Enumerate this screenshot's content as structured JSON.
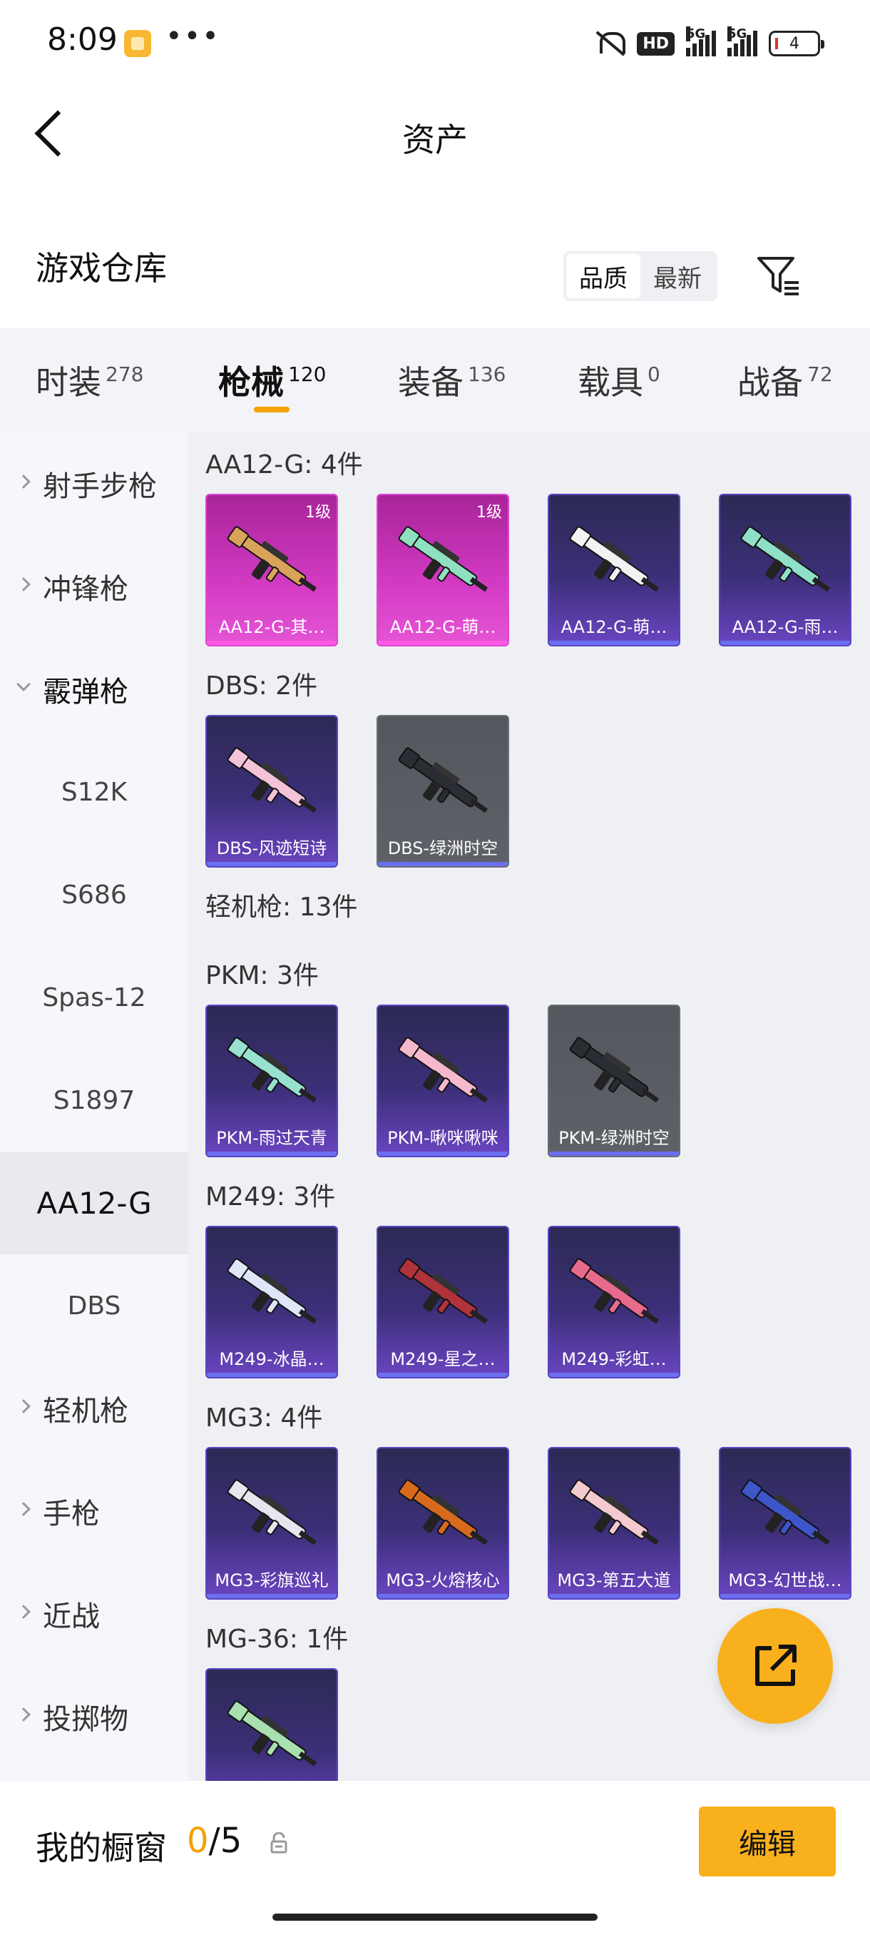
{
  "status": {
    "time": "8:09",
    "dots": "•••",
    "hd": "HD",
    "sig1": "5G",
    "sig2": "5G",
    "battery": "4"
  },
  "header": {
    "title": "资产"
  },
  "warehouse": {
    "title": "游戏仓库",
    "sort": [
      "品质",
      "最新"
    ],
    "sort_active": 0
  },
  "tabs": [
    {
      "label": "时装",
      "count": "278"
    },
    {
      "label": "枪械",
      "count": "120",
      "active": true
    },
    {
      "label": "装备",
      "count": "136"
    },
    {
      "label": "载具",
      "count": "0"
    },
    {
      "label": "战备",
      "count": "72"
    }
  ],
  "leftnav": [
    {
      "label": "射手步枪",
      "type": "parent"
    },
    {
      "label": "冲锋枪",
      "type": "parent"
    },
    {
      "label": "霰弹枪",
      "type": "parent-open"
    },
    {
      "label": "S12K",
      "type": "child"
    },
    {
      "label": "S686",
      "type": "child"
    },
    {
      "label": "Spas-12",
      "type": "child"
    },
    {
      "label": "S1897",
      "type": "child"
    },
    {
      "label": "AA12-G",
      "type": "selected"
    },
    {
      "label": "DBS",
      "type": "child"
    },
    {
      "label": "轻机枪",
      "type": "parent"
    },
    {
      "label": "手枪",
      "type": "parent"
    },
    {
      "label": "近战",
      "type": "parent"
    },
    {
      "label": "投掷物",
      "type": "parent"
    }
  ],
  "groups": [
    {
      "title": "AA12-G: 4件",
      "items": [
        {
          "name": "AA12-G-其…",
          "rarity": "pink",
          "level": "1级",
          "color": "#d9a35a"
        },
        {
          "name": "AA12-G-萌…",
          "rarity": "pink",
          "level": "1级",
          "color": "#8fe0c0"
        },
        {
          "name": "AA12-G-萌…",
          "rarity": "purple",
          "color": "#f2f2f2"
        },
        {
          "name": "AA12-G-雨…",
          "rarity": "purple",
          "color": "#8fe0c8"
        }
      ]
    },
    {
      "title": "DBS: 2件",
      "items": [
        {
          "name": "DBS-风迹短诗",
          "rarity": "purple",
          "color": "#f4c3d8"
        },
        {
          "name": "DBS-绿洲时空",
          "rarity": "gray",
          "color": "#2a2d33"
        }
      ]
    },
    {
      "title": "轻机枪: 13件",
      "items": []
    },
    {
      "title": "PKM: 3件",
      "items": [
        {
          "name": "PKM-雨过天青",
          "rarity": "purple",
          "color": "#98e0d0"
        },
        {
          "name": "PKM-啾咪啾咪",
          "rarity": "purple",
          "color": "#f5b8cc"
        },
        {
          "name": "PKM-绿洲时空",
          "rarity": "gray",
          "color": "#2a2d33"
        }
      ]
    },
    {
      "title": "M249: 3件",
      "items": [
        {
          "name": "M249-冰晶…",
          "rarity": "purple",
          "color": "#dfe6f7"
        },
        {
          "name": "M249-星之…",
          "rarity": "purple",
          "color": "#b0323a"
        },
        {
          "name": "M249-彩虹…",
          "rarity": "purple",
          "color": "#e86a8c"
        }
      ]
    },
    {
      "title": "MG3: 4件",
      "items": [
        {
          "name": "MG3-彩旗巡礼",
          "rarity": "purple",
          "color": "#e6e6ee"
        },
        {
          "name": "MG3-火熔核心",
          "rarity": "purple",
          "color": "#d86a1e"
        },
        {
          "name": "MG3-第五大道",
          "rarity": "purple",
          "color": "#f4c9d0"
        },
        {
          "name": "MG3-幻世战…",
          "rarity": "purple",
          "color": "#3d56c9"
        }
      ]
    },
    {
      "title": "MG-36: 1件",
      "items": [
        {
          "name": "",
          "rarity": "purple",
          "color": "#a8e0b0"
        }
      ]
    }
  ],
  "bottom": {
    "label": "我的橱窗",
    "count_current": "0",
    "count_total": "/5",
    "edit_label": "编辑"
  }
}
